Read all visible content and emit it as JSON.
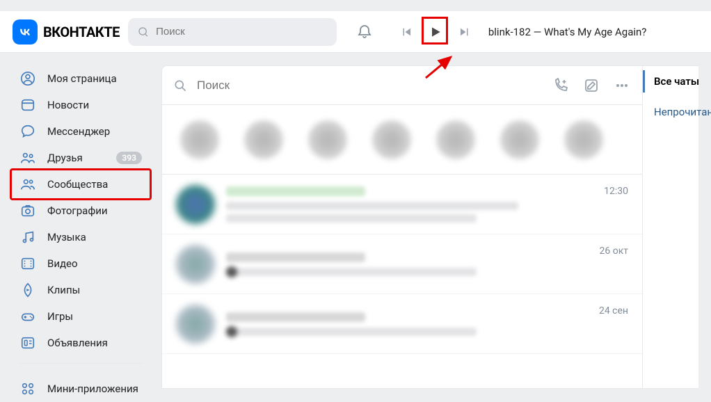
{
  "brand": {
    "name": "ВКОНТАКТЕ"
  },
  "header": {
    "search_placeholder": "Поиск",
    "track": "blink-182 — What's My Age Again?"
  },
  "sidebar": {
    "items": [
      {
        "icon": "user",
        "label": "Моя страница"
      },
      {
        "icon": "news",
        "label": "Новости"
      },
      {
        "icon": "chat",
        "label": "Мессенджер"
      },
      {
        "icon": "friends",
        "label": "Друзья",
        "badge": "393"
      },
      {
        "icon": "groups",
        "label": "Сообщества",
        "highlight": true
      },
      {
        "icon": "photos",
        "label": "Фотографии"
      },
      {
        "icon": "music",
        "label": "Музыка"
      },
      {
        "icon": "video",
        "label": "Видео"
      },
      {
        "icon": "clips",
        "label": "Клипы"
      },
      {
        "icon": "games",
        "label": "Игры"
      },
      {
        "icon": "ads",
        "label": "Объявления"
      }
    ],
    "more_label": "Мини-приложения"
  },
  "messenger": {
    "search_placeholder": "Поиск",
    "conversations": [
      {
        "time": "12:30"
      },
      {
        "time": "26 окт"
      },
      {
        "time": "24 сен"
      }
    ]
  },
  "rail": {
    "tabs": [
      {
        "label": "Все чаты",
        "active": true
      },
      {
        "label": "Непрочитанные"
      }
    ]
  }
}
